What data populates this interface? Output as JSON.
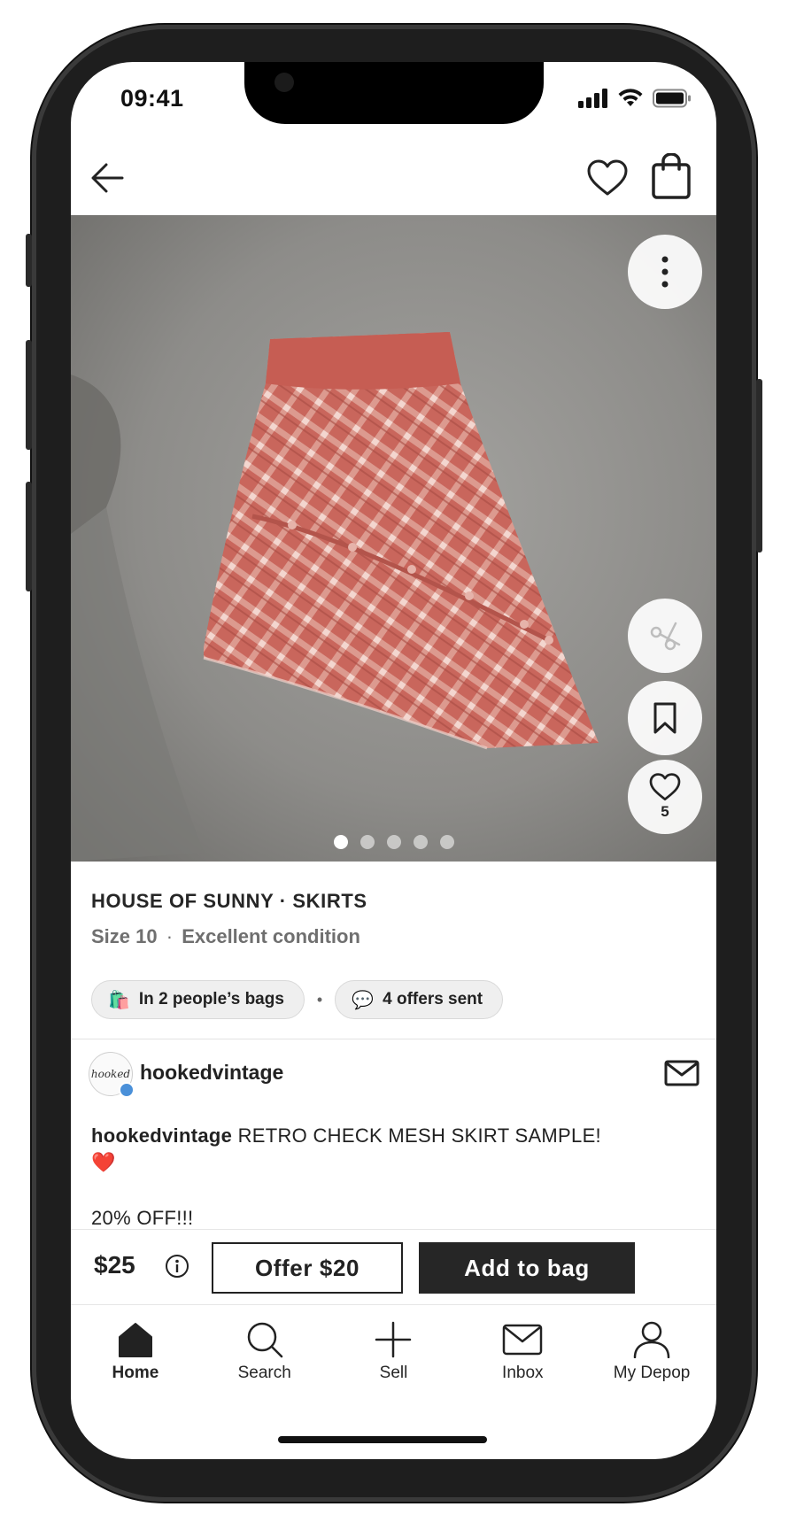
{
  "status_bar": {
    "time": "09:41"
  },
  "product": {
    "brand_category": "HOUSE OF SUNNY · SKIRTS",
    "size": "Size 10",
    "meta_separator": "·",
    "condition": "Excellent condition",
    "photo_count": 5,
    "active_photo": 1,
    "likes": "5"
  },
  "chips": {
    "bags": {
      "emoji": "🛍️",
      "label": "In 2 people’s bags"
    },
    "separator": "•",
    "offers": {
      "emoji": "💬",
      "label": "4 offers sent"
    }
  },
  "seller": {
    "username": "hookedvintage",
    "avatar_text": "hooked"
  },
  "description": {
    "username": "hookedvintage",
    "text": " RETRO CHECK MESH SKIRT SAMPLE!",
    "emoji": "❤️",
    "offer_line": "20% OFF!!!"
  },
  "buy_bar": {
    "price": "$25",
    "offer_button": "Offer $20",
    "add_to_bag_button": "Add to bag"
  },
  "tab_bar": {
    "tabs": [
      {
        "label": "Home",
        "icon": "home-icon",
        "active": true
      },
      {
        "label": "Search",
        "icon": "search-icon",
        "active": false
      },
      {
        "label": "Sell",
        "icon": "plus-icon",
        "active": false
      },
      {
        "label": "Inbox",
        "icon": "mail-icon",
        "active": false
      },
      {
        "label": "My Depop",
        "icon": "user-icon",
        "active": false
      }
    ]
  },
  "colors": {
    "skirt": "#c9665c",
    "dark_button": "#262626",
    "chip_bg": "#efefef"
  }
}
